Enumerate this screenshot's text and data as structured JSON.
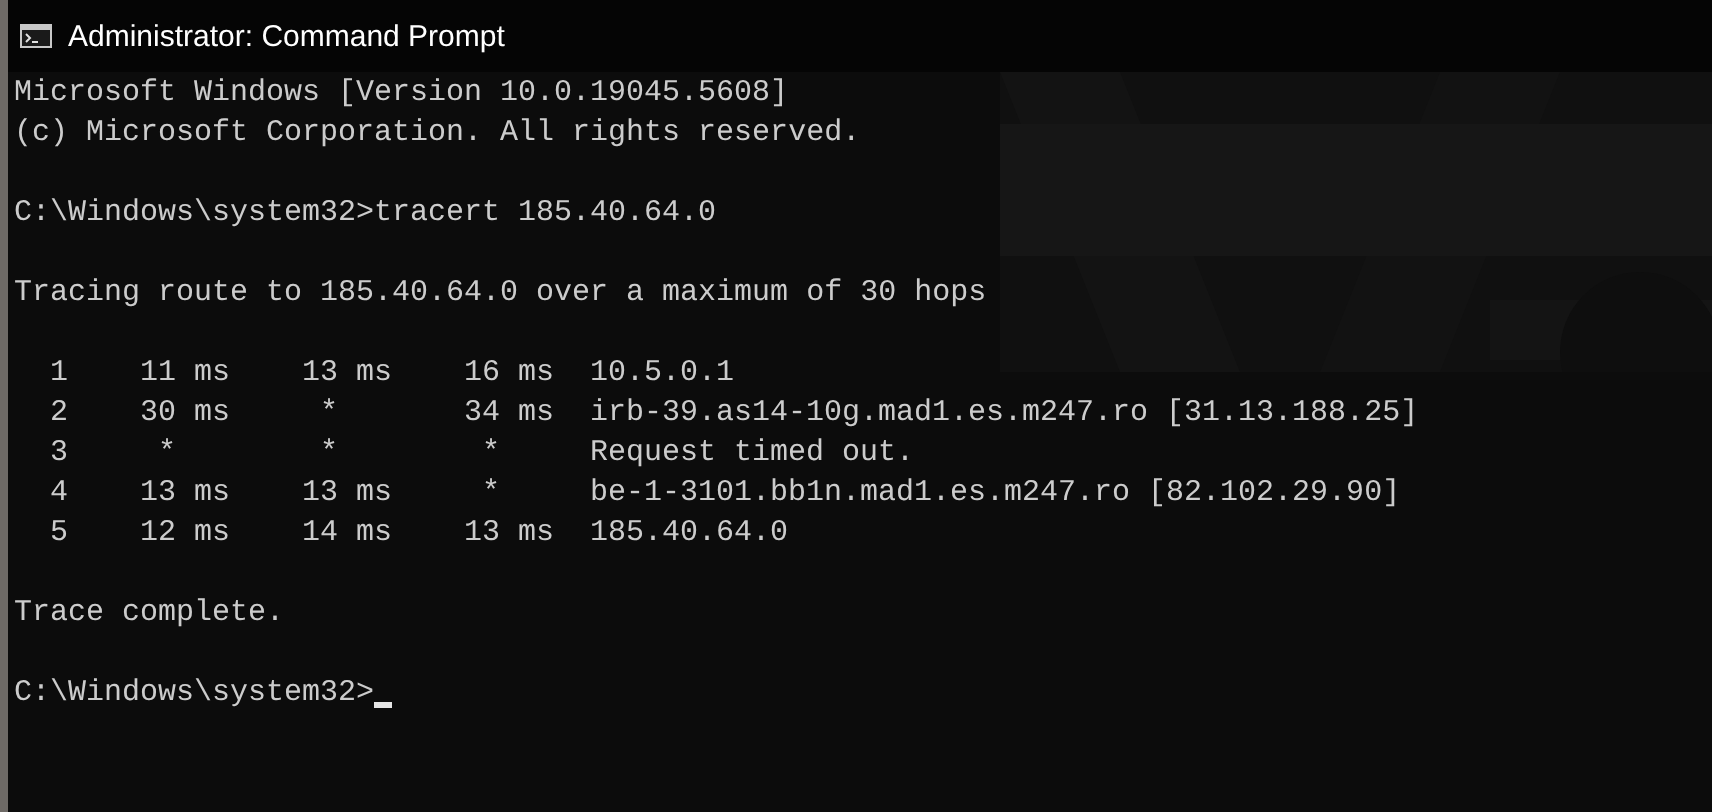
{
  "window": {
    "title": "Administrator: Command Prompt"
  },
  "console": {
    "header": [
      "Microsoft Windows [Version 10.0.19045.5608]",
      "(c) Microsoft Corporation. All rights reserved."
    ],
    "prompt": "C:\\Windows\\system32>",
    "command": "tracert 185.40.64.0",
    "intro": "Tracing route to 185.40.64.0 over a maximum of 30 hops",
    "hops": [
      {
        "hop": "1",
        "times": [
          {
            "text": "11 ms",
            "kind": "ms"
          },
          {
            "text": "13 ms",
            "kind": "ms"
          },
          {
            "text": "16 ms",
            "kind": "ms"
          }
        ],
        "host": "10.5.0.1"
      },
      {
        "hop": "2",
        "times": [
          {
            "text": "30 ms",
            "kind": "ms"
          },
          {
            "text": "*",
            "kind": "timeout"
          },
          {
            "text": "34 ms",
            "kind": "ms"
          }
        ],
        "host": "irb-39.as14-10g.mad1.es.m247.ro [31.13.188.25]"
      },
      {
        "hop": "3",
        "times": [
          {
            "text": "*",
            "kind": "timeout"
          },
          {
            "text": "*",
            "kind": "timeout"
          },
          {
            "text": "*",
            "kind": "timeout"
          }
        ],
        "host": "Request timed out."
      },
      {
        "hop": "4",
        "times": [
          {
            "text": "13 ms",
            "kind": "ms"
          },
          {
            "text": "13 ms",
            "kind": "ms"
          },
          {
            "text": "*",
            "kind": "timeout"
          }
        ],
        "host": "be-1-3101.bb1n.mad1.es.m247.ro [82.102.29.90]"
      },
      {
        "hop": "5",
        "times": [
          {
            "text": "12 ms",
            "kind": "ms"
          },
          {
            "text": "14 ms",
            "kind": "ms"
          },
          {
            "text": "13 ms",
            "kind": "ms"
          }
        ],
        "host": "185.40.64.0"
      }
    ],
    "footer": "Trace complete.",
    "final_prompt": "C:\\Windows\\system32>"
  }
}
